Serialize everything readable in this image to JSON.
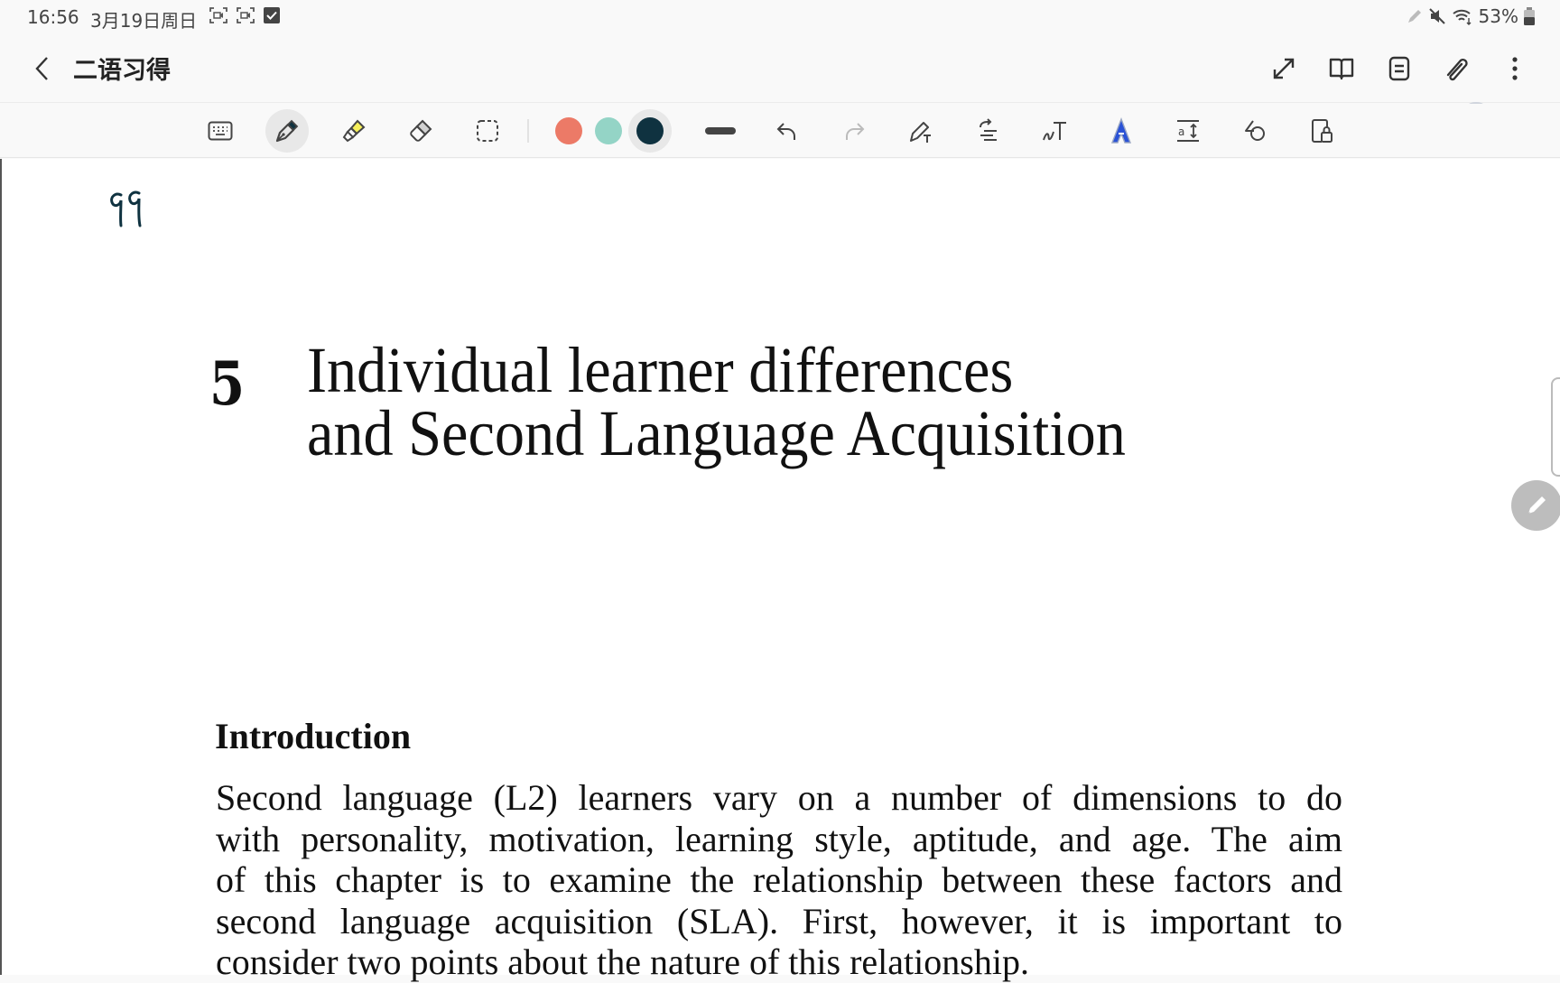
{
  "status_bar": {
    "time": "16:56",
    "date": "3月19日周日",
    "notification_icons": [
      "screen-record-icon",
      "screen-record-icon",
      "checkbox-icon"
    ],
    "right_icons": [
      "pen-icon",
      "mute-icon",
      "wifi-icon"
    ],
    "battery": "53%"
  },
  "app_bar": {
    "title": "二语习得",
    "actions": [
      "expand-icon",
      "book-view-icon",
      "page-list-icon",
      "attachment-icon",
      "more-icon"
    ]
  },
  "toolbar": {
    "tools": [
      "keyboard",
      "pen",
      "highlighter",
      "eraser",
      "lasso-select"
    ],
    "active_tool": "pen",
    "colors": [
      "#ec7a67",
      "#94d4c6",
      "#0f3240"
    ],
    "active_color": "#0f3240",
    "extra_tools": [
      "stroke-width",
      "undo",
      "redo",
      "pen-to-text",
      "text-align",
      "handwriting-to-text",
      "text-style",
      "text-spacing",
      "shapes",
      "read-only-lock"
    ]
  },
  "document": {
    "handwritten_note": "99",
    "chapter_number": "5",
    "chapter_title_lines": [
      "Individual learner differences",
      "and Second Language Acquisition"
    ],
    "section_heading": "Introduction",
    "body_lines": [
      "Second language (L2) learners vary on a number of dimensions to do",
      "with personality, motivation, learning style, aptitude, and age. The aim",
      "of this chapter is to examine the relationship between these factors and",
      "second language acquisition (SLA). First, however, it is important to",
      "consider two points about the nature of this relationship."
    ]
  }
}
